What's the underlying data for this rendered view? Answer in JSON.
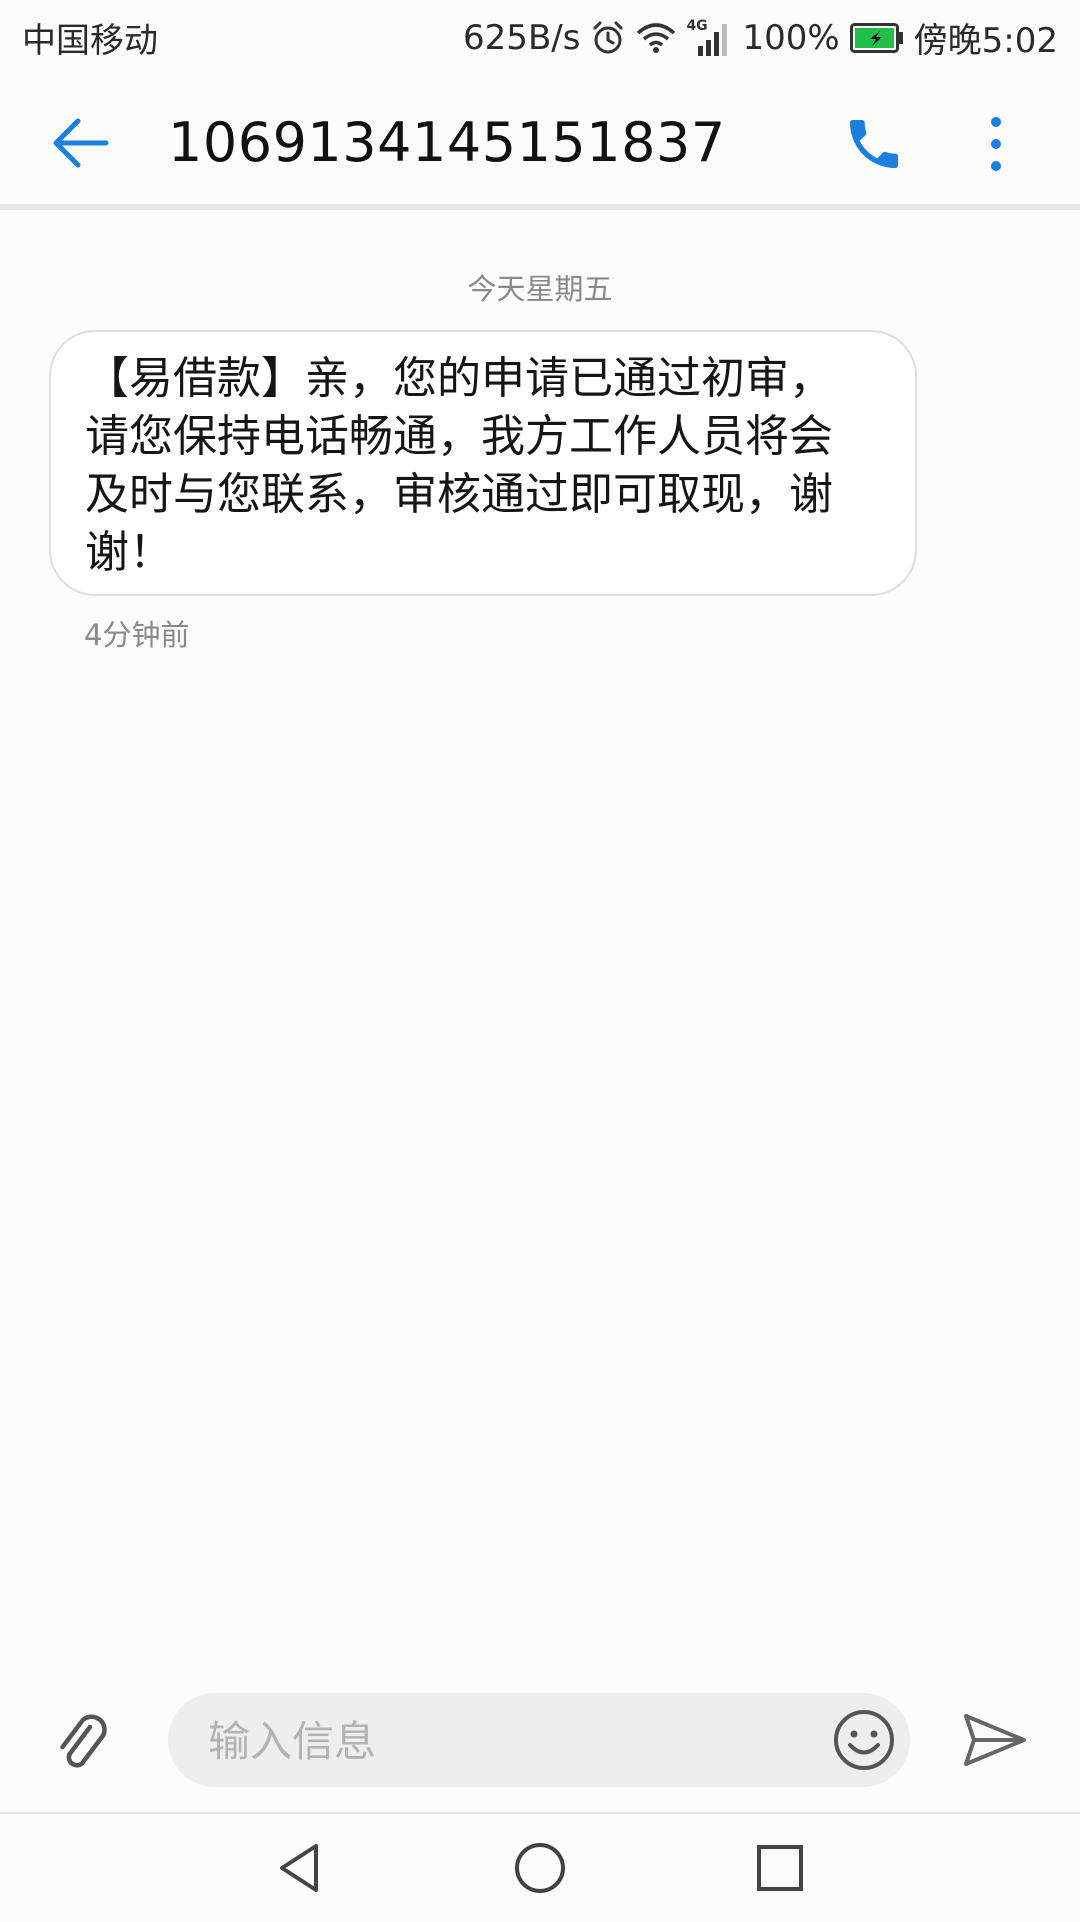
{
  "status_bar": {
    "carrier": "中国移动",
    "net_speed": "625B/s",
    "network_type": "4G",
    "battery": "100%",
    "time": "傍晚5:02",
    "icons": [
      "alarm-icon",
      "wifi-icon",
      "signal-icon",
      "battery-icon"
    ]
  },
  "header": {
    "contact": "1069134145151837",
    "icons": [
      "back-arrow-icon",
      "phone-icon",
      "more-vert-icon"
    ]
  },
  "conversation": {
    "date_label": "今天星期五",
    "messages": [
      {
        "text": "【易借款】亲，您的申请已通过初审，请您保持电话畅通，我方工作人员将会及时与您联系，审核通过即可取现，谢谢！",
        "time": "4分钟前"
      }
    ]
  },
  "compose": {
    "placeholder": "输入信息",
    "value": "",
    "icons": [
      "paperclip-icon",
      "emoji-icon",
      "send-icon"
    ]
  },
  "nav": {
    "icons": [
      "nav-back-icon",
      "nav-home-icon",
      "nav-recents-icon"
    ]
  },
  "colors": {
    "accent": "#1a7fe0",
    "battery_green": "#22c04a",
    "background": "#fcfcfc"
  }
}
